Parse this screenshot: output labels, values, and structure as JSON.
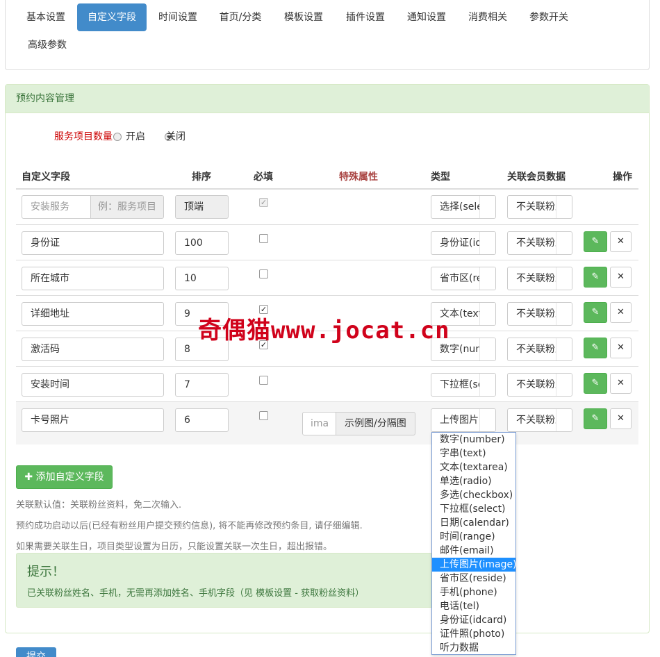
{
  "tabs": [
    {
      "label": "基本设置"
    },
    {
      "label": "自定义字段",
      "active": true
    },
    {
      "label": "时间设置"
    },
    {
      "label": "首页/分类"
    },
    {
      "label": "模板设置"
    },
    {
      "label": "插件设置"
    },
    {
      "label": "通知设置"
    },
    {
      "label": "消费相关"
    },
    {
      "label": "参数开关"
    },
    {
      "label": "高级参数"
    }
  ],
  "panel": {
    "title": "预约内容管理",
    "service_count": {
      "label": "服务项目数量",
      "on_label": "开启",
      "off_label": "关闭",
      "selected": "关闭"
    }
  },
  "table": {
    "headers": {
      "field": "自定义字段",
      "order": "排序",
      "required": "必填",
      "special": "特殊属性",
      "type": "类型",
      "member": "关联会员数据",
      "action": "操作"
    },
    "first_row": {
      "field_placeholder": "安装服务",
      "field_addon": "例：服务项目",
      "order": "顶端",
      "required": true,
      "type": "选择(select)",
      "member": "不关联粉丝"
    },
    "rows": [
      {
        "field": "身份证",
        "order": "100",
        "required": false,
        "type": "身份证(idcard)",
        "member": "不关联粉丝"
      },
      {
        "field": "所在城市",
        "order": "10",
        "required": false,
        "type": "省市区(reside)",
        "member": "不关联粉丝"
      },
      {
        "field": "详细地址",
        "order": "9",
        "required": true,
        "type": "文本(textarea)",
        "member": "不关联粉丝"
      },
      {
        "field": "激活码",
        "order": "8",
        "required": true,
        "type": "数字(number)",
        "member": "不关联粉丝"
      },
      {
        "field": "安装时间",
        "order": "7",
        "required": false,
        "type": "下拉框(select)",
        "member": "不关联粉丝"
      },
      {
        "field": "卡号照片",
        "order": "6",
        "required": false,
        "special_value": "ima",
        "special_addon": "示例图/分隔图",
        "type": "上传图片(image)",
        "member": "不关联粉丝"
      }
    ]
  },
  "add_button": "添加自定义字段",
  "notes": [
    "关联默认值：关联粉丝资料，免二次输入.",
    "预约成功启动以后(已经有粉丝用户提交预约信息), 将不能再修改预约条目, 请仔细编辑.",
    "如果需要关联生日，项目类型设置为日历，只能设置关联一次生日，超出报错。"
  ],
  "alert": {
    "title": "提示！",
    "text": "已关联粉丝姓名、手机，无需再添加姓名、手机字段（见 模板设置 - 获取粉丝资料）"
  },
  "submit": "提交",
  "watermark": "奇偶猫www.jocat.cn",
  "dropdown": {
    "selected": "上传图片(image)",
    "options": [
      "数字(number)",
      "字串(text)",
      "文本(textarea)",
      "单选(radio)",
      "多选(checkbox)",
      "下拉框(select)",
      "日期(calendar)",
      "时间(range)",
      "邮件(email)",
      "上传图片(image)",
      "省市区(reside)",
      "手机(phone)",
      "电话(tel)",
      "身份证(idcard)",
      "证件照(photo)",
      "听力数据"
    ]
  },
  "colors": {
    "primary": "#428bca",
    "success": "#5cb85c",
    "panel_head": "#dff0d8",
    "required_label": "#cc0000",
    "watermark": "#d0021b"
  }
}
